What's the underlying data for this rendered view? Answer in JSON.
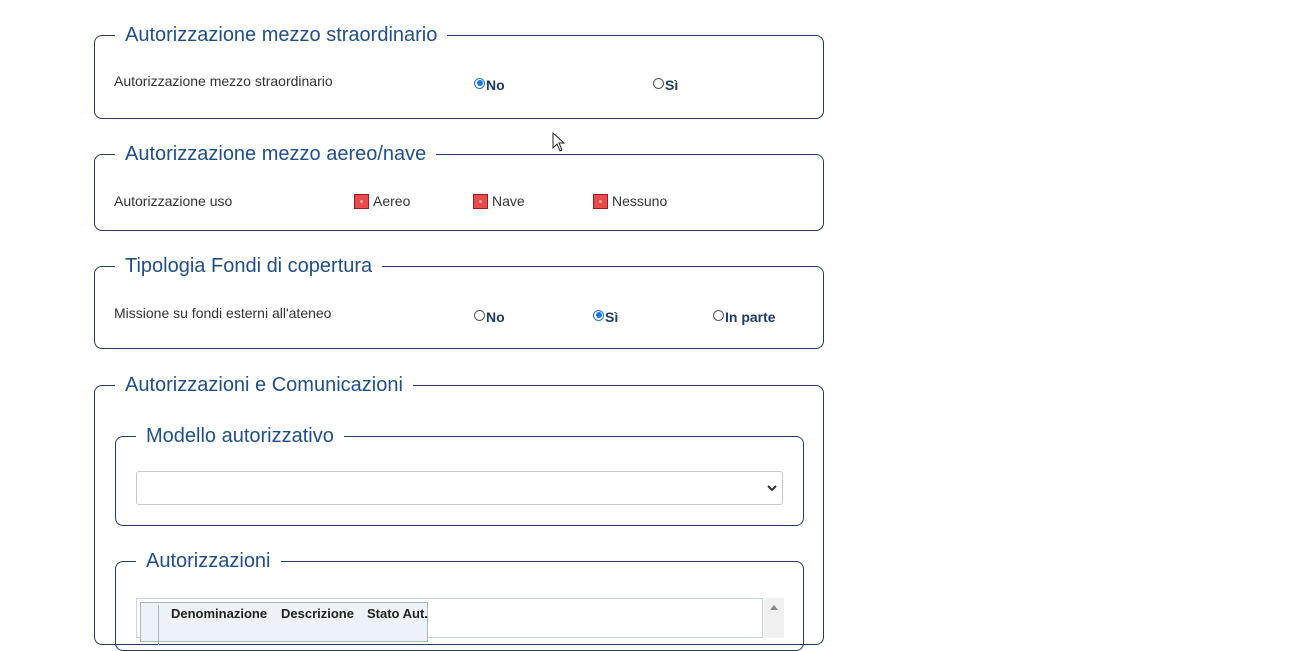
{
  "fieldset_straordinario": {
    "legend": "Autorizzazione mezzo straordinario",
    "label": "Autorizzazione mezzo straordinario",
    "options": [
      {
        "label": "No",
        "checked": true
      },
      {
        "label": "Sì",
        "checked": false
      }
    ]
  },
  "fieldset_aereo_nave": {
    "legend": "Autorizzazione mezzo aereo/nave",
    "label": "Autorizzazione uso",
    "options": [
      {
        "label": "Aereo"
      },
      {
        "label": "Nave"
      },
      {
        "label": "Nessuno"
      }
    ]
  },
  "fieldset_fondi": {
    "legend": "Tipologia Fondi di copertura",
    "label": "Missione su fondi esterni all'ateneo",
    "options": [
      {
        "label": "No",
        "checked": false
      },
      {
        "label": "Sì",
        "checked": true
      },
      {
        "label": "In parte",
        "checked": false
      }
    ]
  },
  "fieldset_autorizzazioni": {
    "legend": "Autorizzazioni e Comunicazioni",
    "modello": {
      "legend": "Modello autorizzativo",
      "selected": ""
    },
    "autorizzazioni": {
      "legend": "Autorizzazioni",
      "columns": [
        "Denominazione",
        "Descrizione",
        "Stato Aut."
      ]
    }
  },
  "colors": {
    "accent": "#1f4f8a",
    "border": "#1f3b66",
    "radio": "#1a73e8",
    "checkbox": "#e74b4b"
  }
}
